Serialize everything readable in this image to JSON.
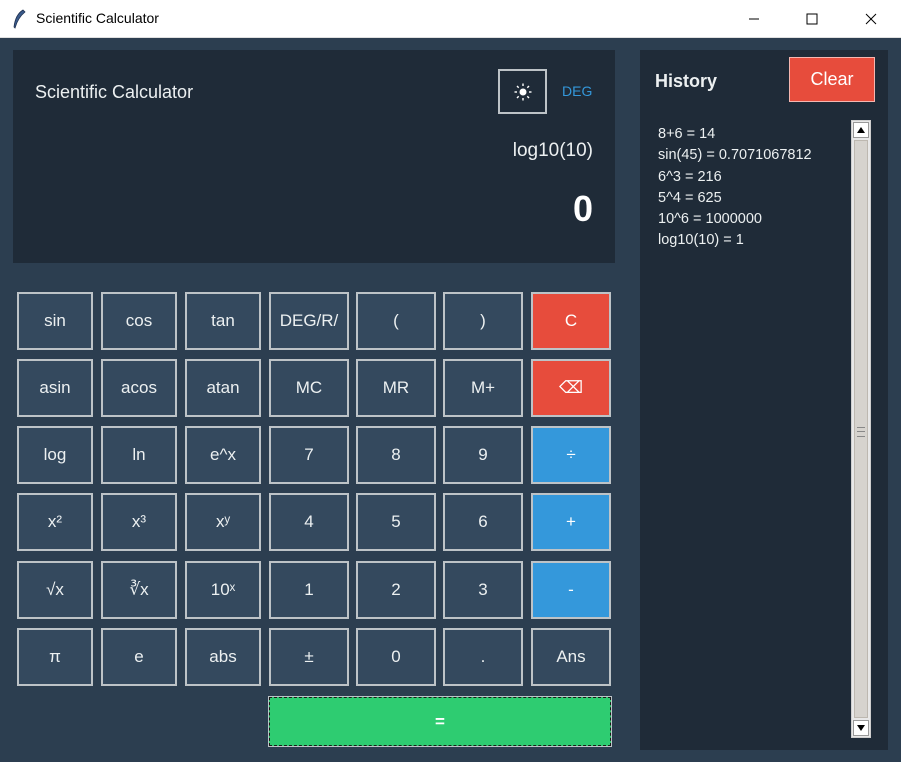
{
  "window": {
    "title": "Scientific Calculator",
    "minimize_icon": "minimize-icon",
    "maximize_icon": "maximize-icon",
    "close_icon": "close-icon"
  },
  "display": {
    "title": "Scientific Calculator",
    "theme_icon": "sun-icon",
    "mode": "DEG",
    "expression": "log10(10)",
    "result": "0"
  },
  "keys": {
    "sin": "sin",
    "cos": "cos",
    "tan": "tan",
    "degrad": "DEG/R/",
    "lparen": "(",
    "rparen": ")",
    "clear": "C",
    "asin": "asin",
    "acos": "acos",
    "atan": "atan",
    "mc": "MC",
    "mr": "MR",
    "mplus": "M+",
    "backspace": "⌫",
    "log": "log",
    "ln": "ln",
    "exp": "e^x",
    "seven": "7",
    "eight": "8",
    "nine": "9",
    "divide": "÷",
    "square": "x²",
    "cube": "x³",
    "power": "xʸ",
    "four": "4",
    "five": "5",
    "six": "6",
    "plus": "+",
    "sqrt": "√x",
    "cbrt": "∛x",
    "tenpow": "10ˣ",
    "one": "1",
    "two": "2",
    "three": "3",
    "minus": "-",
    "pi": "π",
    "e": "e",
    "abs": "abs",
    "plusminus": "±",
    "zero": "0",
    "dot": ".",
    "ans": "Ans",
    "equals": "="
  },
  "history": {
    "title": "History",
    "clear_label": "Clear",
    "items": [
      "8+6 = 14",
      "sin(45) = 0.7071067812",
      "6^3 = 216",
      "5^4 = 625",
      "10^6 = 1000000",
      "log10(10) = 1"
    ]
  },
  "colors": {
    "background": "#2c3e50",
    "panel": "#1f2b38",
    "key": "#34495e",
    "danger": "#e74c3c",
    "operator": "#3498db",
    "equals": "#2ecc71",
    "mode": "#3498db"
  }
}
